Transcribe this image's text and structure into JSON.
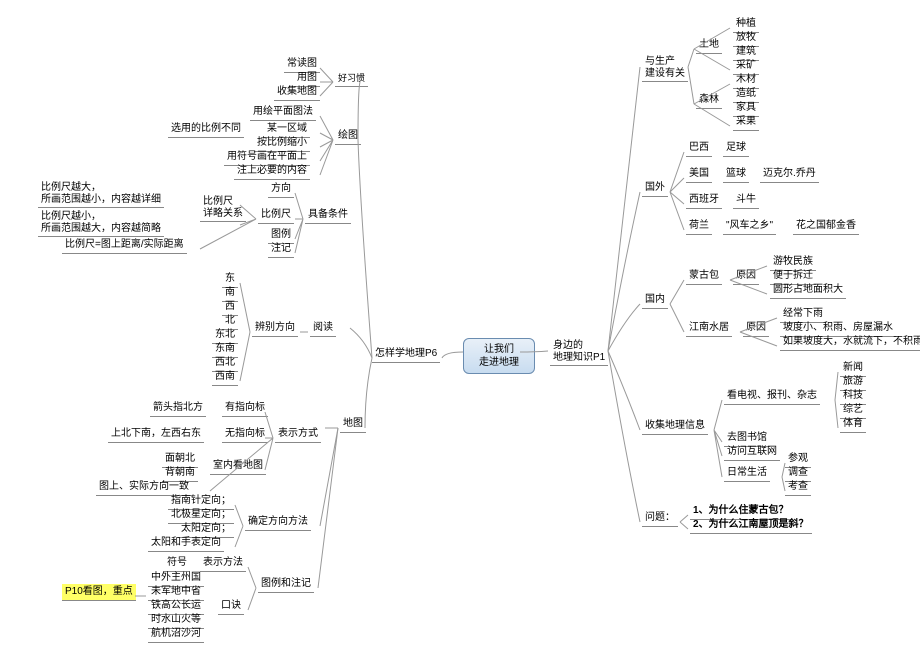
{
  "center": "让我们\n走进地理",
  "mainLeft": "怎样学地理P6",
  "mainRight": "身边的\n地理知识P1",
  "left": {
    "habit": {
      "label": "好习惯",
      "items": [
        "常读图",
        "用图",
        "收集地图"
      ]
    },
    "draw": {
      "label": "绘图",
      "top": "用绘平面图法",
      "scale": "选用的比例不同",
      "items": [
        "某一区域",
        "按比例缩小",
        "用符号画在平面上",
        "注上必要的内容"
      ]
    },
    "elements": {
      "label": "具备条件",
      "items": [
        "方向",
        "比例尺",
        "图例",
        "注记"
      ]
    },
    "scaleRel": {
      "label": "比例尺\n详略关系",
      "big": "比例尺越大，\n所画范围越小，内容越详细",
      "small": "比例尺越小，\n所画范围越大，内容越简略",
      "formula": "比例尺=图上距离/实际距离"
    },
    "read": {
      "label": "阅读",
      "sub": "辨别方向",
      "dirs": [
        "东",
        "南",
        "西",
        "北",
        "东北",
        "东南",
        "西北",
        "西南"
      ]
    },
    "map": "地图",
    "show": {
      "label": "表示方式",
      "compass": {
        "label": "有指向标",
        "item": "箭头指北方"
      },
      "noCompass": {
        "label": "无指向标",
        "item": "上北下南，左西右东"
      },
      "indoor": {
        "label": "室内看地图",
        "items": [
          "面朝北",
          "背朝南"
        ]
      },
      "consistent": "图上、实际方向一致"
    },
    "method": {
      "label": "确定方向方法",
      "items": [
        "指南针定向；",
        "北极星定向；",
        "太阳定向；",
        "太阳和手表定向"
      ]
    },
    "legend": {
      "label": "图例和注记",
      "symbol": {
        "label": "表示方法",
        "item": "符号"
      },
      "rhyme": {
        "label": "口诀",
        "items": [
          "中外主州国",
          "未军地中省",
          "铁高公长运",
          "时水山火等",
          "航机沼沙河"
        ]
      }
    },
    "p10": "P10看图，重点"
  },
  "right": {
    "prod": {
      "label": "与生产\n建设有关",
      "land": {
        "label": "土地",
        "items": [
          "种植",
          "放牧",
          "建筑",
          "采矿"
        ]
      },
      "forest": {
        "label": "森林",
        "items": [
          "木材",
          "造纸",
          "家具",
          "采果"
        ]
      }
    },
    "foreign": {
      "label": "国外",
      "brazil": {
        "label": "巴西",
        "item": "足球"
      },
      "usa": {
        "label": "美国",
        "item": "篮球",
        "extra": "迈克尔.乔丹"
      },
      "spain": {
        "label": "西班牙",
        "item": "斗牛"
      },
      "holland": {
        "label": "荷兰",
        "item": "\"风车之乡\"",
        "extra": "花之国郁金香"
      }
    },
    "domestic": {
      "label": "国内",
      "mongol": {
        "label": "蒙古包",
        "cause": "原因",
        "items": [
          "游牧民族",
          "便于拆迁",
          "圆形占地面积大"
        ]
      },
      "jiangnan": {
        "label": "江南水居",
        "cause": "原因",
        "items": [
          "经常下雨",
          "坡度小、积雨、房屋漏水",
          "如果坡度大，水就流下，不积雨"
        ]
      }
    },
    "collect": {
      "label": "收集地理信息",
      "tv": {
        "label": "看电视、报刊、杂志",
        "items": [
          "新闻",
          "旅游",
          "科技",
          "综艺",
          "体育"
        ]
      },
      "lib": "去图书馆",
      "net": "访问互联网",
      "daily": {
        "label": "日常生活",
        "items": [
          "参观",
          "调查",
          "考查"
        ]
      }
    },
    "q": {
      "label": "问题：",
      "q1": "1、为什么住蒙古包？",
      "q2": "2、为什么江南屋顶是斜？"
    }
  }
}
